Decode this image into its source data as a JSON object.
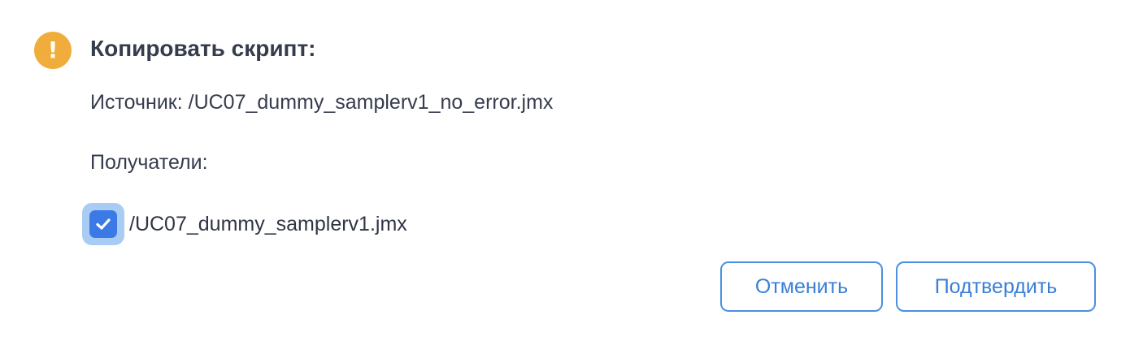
{
  "dialog": {
    "icon": "warning-icon",
    "icon_glyph": "!",
    "title": "Копировать скрипт:",
    "source_text": "Источник: /UC07_dummy_samplerv1_no_error.jmx",
    "recipients_label": "Получатели:",
    "recipients": [
      {
        "label": "/UC07_dummy_samplerv1.jmx",
        "checked": true
      }
    ],
    "buttons": {
      "cancel_label": "Отменить",
      "confirm_label": "Подтвердить"
    }
  },
  "colors": {
    "warning": "#f0ad3c",
    "accent": "#3a79e6",
    "focus_ring": "#a8ccf3",
    "button_border": "#4a90e2",
    "text": "#353c4c"
  }
}
